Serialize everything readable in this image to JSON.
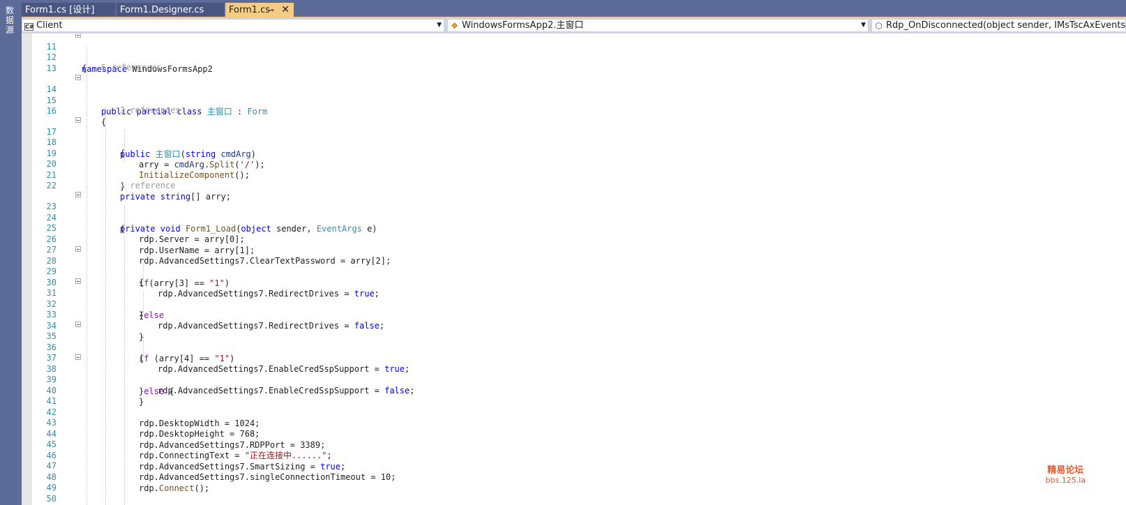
{
  "side_strip": {
    "label": "数据源"
  },
  "tabs": [
    {
      "label": "Form1.cs [设计]",
      "state": "inactive"
    },
    {
      "label": "Form1.Designer.cs",
      "state": "inactive"
    },
    {
      "label": "Form1.cs",
      "state": "active",
      "pin_icon": "pin-icon",
      "close_icon": "close-icon"
    }
  ],
  "navbar": {
    "project": {
      "icon": "csharp-project-icon",
      "value": "Client"
    },
    "type": {
      "icon": "class-icon",
      "value": "WindowsFormsApp2.主窗口"
    },
    "member": {
      "icon": "method-icon",
      "value": "Rdp_OnDisconnected(object sender, IMsTscAxEvents"
    }
  },
  "codelens": {
    "class_refs": "5 references",
    "ctor_refs": "2 references",
    "load_refs": "1 reference"
  },
  "code": {
    "l11": "namespace WindowsFormsApp2",
    "l12": "{",
    "l14_kw": "public partial class",
    "l14_name": "主窗口",
    "l14_sep": " : ",
    "l14_base": "Form",
    "l16": "{",
    "l17_kw": "public",
    "l17_name": "主窗口",
    "l17_open": "(",
    "l17_ptype": "string",
    "l17_param": "cmdArg",
    "l17_close": ")",
    "l18": "{",
    "l19_a": "arry = ",
    "l19_p": "cmdArg",
    "l19_dot": ".",
    "l19_m": "Split",
    "l19_op": "(",
    "l19_s": "'/'",
    "l19_end": ");",
    "l20_m": "InitializeComponent",
    "l20_end": "();",
    "l21": "}",
    "l22_kw": "private string",
    "l22_rest": "[] arry;",
    "l23_kw": "private void",
    "l23_m": "Form1_Load",
    "l23_open": "(",
    "l23_kw2": "object",
    "l23_p1": " sender, ",
    "l23_ty": "EventArgs",
    "l23_p2": " e)",
    "l24": "{",
    "l25": "rdp.Server = arry[0];",
    "l26": "rdp.UserName = arry[1];",
    "l27": "rdp.AdvancedSettings7.ClearTextPassword = arry[2];",
    "l28_kw": "if",
    "l28_a": "(arry[3] == ",
    "l28_s": "\"1\"",
    "l28_b": ")",
    "l29": "{",
    "l30_a": "rdp.AdvancedSettings7.RedirectDrives = ",
    "l30_kw": "true",
    "l30_b": ";",
    "l31_a": "}",
    "l31_kw": "else",
    "l32": "{",
    "l33_a": "rdp.AdvancedSettings7.RedirectDrives = ",
    "l33_kw": "false",
    "l33_b": ";",
    "l34": "}",
    "l35_kw": "if",
    "l35_a": " (arry[4] == ",
    "l35_s": "\"1\"",
    "l35_b": ")",
    "l36": "{",
    "l37_a": "rdp.AdvancedSettings7.EnableCredSspSupport = ",
    "l37_kw": "true",
    "l37_b": ";",
    "l38_a": "}",
    "l38_kw": "else",
    "l38_b": " {",
    "l39_a": "rdp.AdvancedSettings7.EnableCredSspSupport = ",
    "l39_kw": "false",
    "l39_b": ";",
    "l40": "}",
    "l42": "rdp.DesktopWidth = 1024;",
    "l43": "rdp.DesktopHeight = 768;",
    "l44": "rdp.AdvancedSettings7.RDPPort = 3389;",
    "l45_a": "rdp.ConnectingText = ",
    "l45_s": "\"正在连接中......\"",
    "l45_b": ";",
    "l46_a": "rdp.AdvancedSettings7.SmartSizing = ",
    "l46_kw": "true",
    "l46_b": ";",
    "l47": "rdp.AdvancedSettings7.singleConnectionTimeout = 10;",
    "l48_a": "rdp.",
    "l48_m": "Connect",
    "l48_b": "();",
    "l50": "}"
  },
  "line_numbers": [
    "11",
    "12",
    "13",
    "14",
    "15",
    "16",
    "17",
    "18",
    "19",
    "20",
    "21",
    "22",
    "23",
    "24",
    "25",
    "26",
    "27",
    "28",
    "29",
    "30",
    "31",
    "32",
    "33",
    "34",
    "35",
    "36",
    "37",
    "38",
    "39",
    "40",
    "41",
    "42",
    "43",
    "44",
    "45",
    "46",
    "47",
    "48",
    "49",
    "50"
  ],
  "watermark": {
    "line1": "精易论坛",
    "line2": "bbs.125.la"
  },
  "colors": {
    "tab_bar": "#5d6b99",
    "active_tab": "#f5cc84",
    "keyword": "#0000ff",
    "type": "#2b91af",
    "method": "#74531f",
    "string": "#a31515",
    "control_keyword": "#8f08c4",
    "line_number": "#2b91af",
    "codelens": "#999999"
  }
}
